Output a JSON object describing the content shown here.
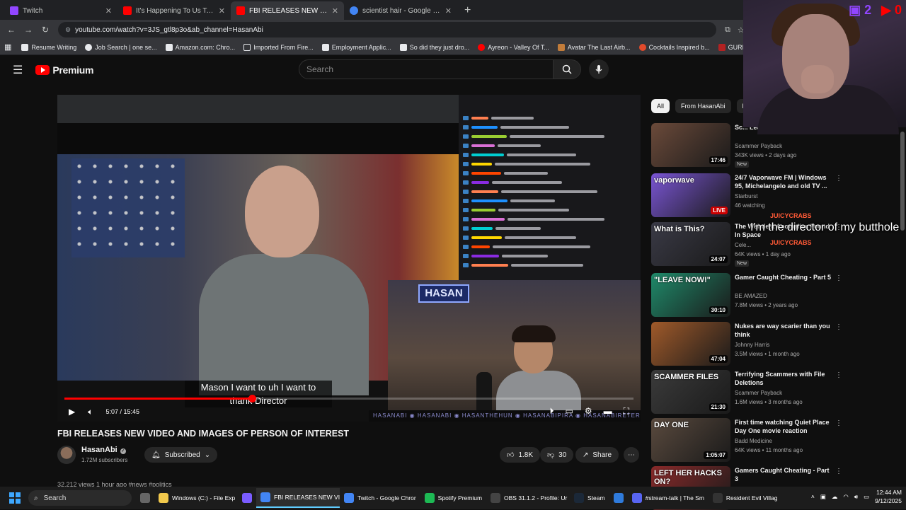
{
  "browser": {
    "tabs": [
      {
        "title": "Twitch",
        "color": "#9146ff",
        "active": false
      },
      {
        "title": "It's Happening To Us Too - YouT",
        "color": "#ff0000",
        "active": false
      },
      {
        "title": "FBI RELEASES NEW VIDEO AND",
        "color": "#ff0000",
        "active": true
      },
      {
        "title": "scientist hair - Google Search",
        "color": "#4285f4",
        "active": false
      }
    ],
    "url": "youtube.com/watch?v=3JS_gtl8p3o&ab_channel=HasanAbi",
    "bookmarks": [
      {
        "label": "Resume Writing",
        "color": "#ffffff"
      },
      {
        "label": "Job Search | one se...",
        "color": "#ffffff"
      },
      {
        "label": "Amazon.com: Chro...",
        "color": "#ffffff"
      },
      {
        "label": "Imported From Fire...",
        "color": "#e8eaed"
      },
      {
        "label": "Employment Applic...",
        "color": "#ffffff"
      },
      {
        "label": "So did they just dro...",
        "color": "#ffffff"
      },
      {
        "label": "Ayreon - Valley Of T...",
        "color": "#ff0000"
      },
      {
        "label": "Avatar The Last Airb...",
        "color": "#c27c3a"
      },
      {
        "label": "Cocktails Inspired b...",
        "color": "#e24a2b"
      },
      {
        "label": "GURPS Character Te...",
        "color": "#b32222"
      }
    ]
  },
  "youtube": {
    "logo_text": "Premium",
    "search_placeholder": "Search"
  },
  "video": {
    "subtitle_line1": "Mason I want to uh I want to",
    "subtitle_line2": "thank Director",
    "overlay_sign": "HASAN",
    "overlay_bar": "HASANABI  ◉ HASANABI  ◉ HASANTHEHUN  ◉ HASANABIPIRA  ◉ HASANABIRETERD",
    "time": "5:07 / 15:45",
    "progress": 0.33,
    "title": "FBI RELEASES NEW VIDEO AND IMAGES OF PERSON OF INTEREST",
    "channel": "HasanAbi",
    "subscribers": "1.72M subscribers",
    "subscribe_label": "Subscribed",
    "likes": "1.8K",
    "dislikes": "30",
    "share_label": "Share",
    "description_peek": "32,212 views  1 hour ago  #news #politics"
  },
  "sidebar": {
    "chips": [
      "All",
      "From HasanAbi",
      "R"
    ],
    "recommendations": [
      {
        "title": "Sc... Leaves in Handcuffs",
        "channel": "Scammer Payback",
        "meta": "343K views • 2 days ago",
        "badge": "New",
        "duration": "17:46",
        "thumb_color": "#6b4a3a",
        "thumb_text": ""
      },
      {
        "title": "24/7 Vaporwave FM | Windows 95, Michelangelo and old TV ...",
        "channel": "Starburst",
        "meta": "46 watching",
        "badge": "",
        "duration": "LIVE",
        "thumb_color": "#7a55d4",
        "thumb_text": "vaporwave"
      },
      {
        "title": "The Weirdest Anomalies Found In Space",
        "channel": "Cele...",
        "meta": "64K views • 1 day ago",
        "badge": "New",
        "duration": "24:07",
        "thumb_color": "#3a3a46",
        "thumb_text": "What is This?"
      },
      {
        "title": "Gamer Caught Cheating - Part 5",
        "channel": "BE AMAZED",
        "meta": "7.8M views • 2 years ago",
        "badge": "",
        "duration": "30:10",
        "thumb_color": "#1f8a6a",
        "thumb_text": "\"LEAVE NOW!\""
      },
      {
        "title": "Nukes are way scarier than you think",
        "channel": "Johnny Harris",
        "meta": "3.5M views • 1 month ago",
        "badge": "",
        "duration": "47:04",
        "thumb_color": "#a05a2a",
        "thumb_text": ""
      },
      {
        "title": "Terrifying Scammers with File Deletions",
        "channel": "Scammer Payback",
        "meta": "1.6M views • 3 months ago",
        "badge": "",
        "duration": "21:30",
        "thumb_color": "#3b3b3b",
        "thumb_text": "SCAMMER FILES"
      },
      {
        "title": "First time watching Quiet Place Day One movie reaction",
        "channel": "Badd Medicine",
        "meta": "64K views • 11 months ago",
        "badge": "",
        "duration": "1:05:07",
        "thumb_color": "#5a4a3e",
        "thumb_text": "DAY ONE"
      },
      {
        "title": "Gamers Caught Cheating - Part 3",
        "channel": "",
        "meta": "",
        "badge": "",
        "duration": "",
        "thumb_color": "#8a2a2a",
        "thumb_text": "LEFT HER HACKS ON?"
      }
    ]
  },
  "stream_overlay": {
    "counter_left": "2",
    "counter_right": "0",
    "chat_user_1": "JUICYCRABS",
    "chat_message": "I'm the director of my butthole",
    "chat_user_2": "JUICYCRABS"
  },
  "taskbar": {
    "search_label": "Search",
    "items": [
      {
        "label": "Windows (C:) - File Exp",
        "color": "#f2c94c",
        "active": false
      },
      {
        "label": "",
        "color": "#7a5cff",
        "active": false
      },
      {
        "label": "FBI RELEASES NEW VI",
        "color": "#4285f4",
        "active": true
      },
      {
        "label": "Twitch - Google Chror",
        "color": "#4285f4",
        "active": false
      },
      {
        "label": "Spotify Premium",
        "color": "#1db954",
        "active": false
      },
      {
        "label": "OBS 31.1.2 - Profile: Ur",
        "color": "#444444",
        "active": false
      },
      {
        "label": "Steam",
        "color": "#1b2838",
        "active": false
      },
      {
        "label": "",
        "color": "#2f7bdc",
        "active": false
      },
      {
        "label": "#stream-talk | The Sm",
        "color": "#5865f2",
        "active": false
      },
      {
        "label": "Resident Evil Villag",
        "color": "#333333",
        "active": false
      }
    ],
    "time": "12:44 AM",
    "date": "9/12/2025"
  }
}
